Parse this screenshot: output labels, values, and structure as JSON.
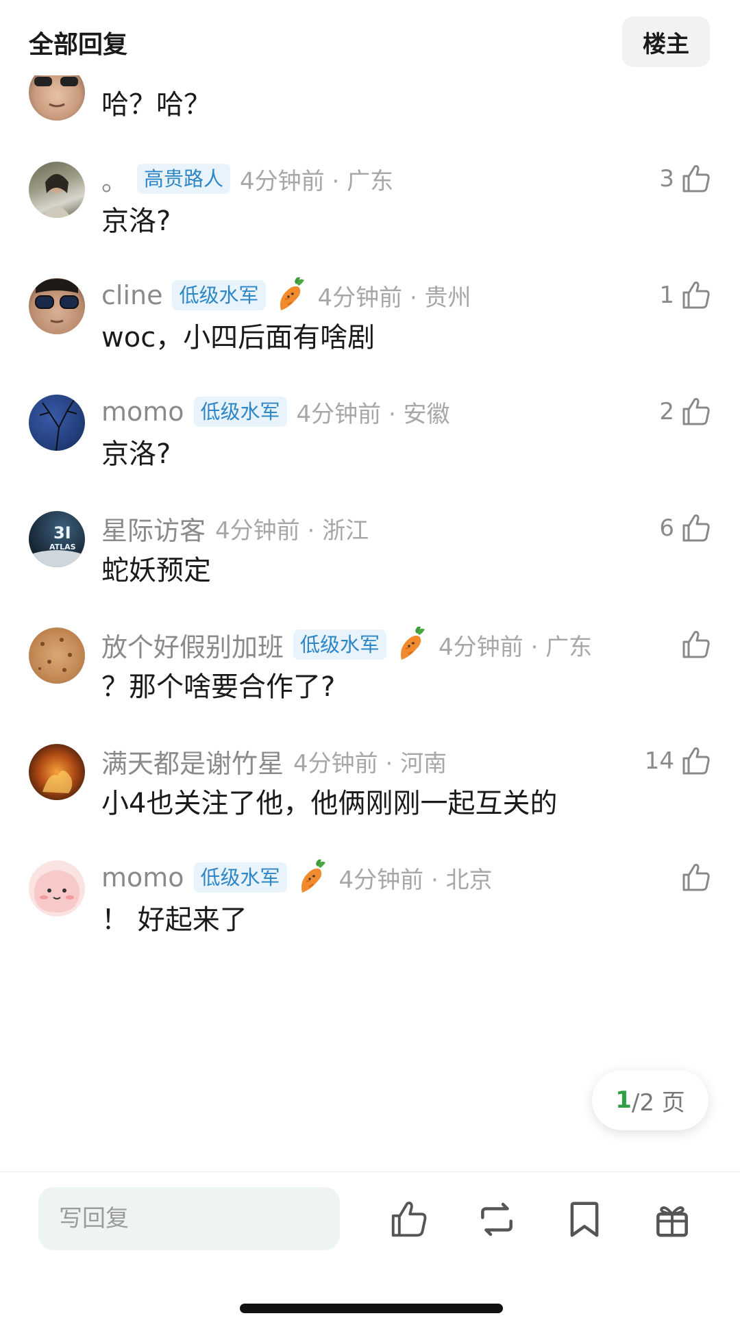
{
  "header": {
    "title": "全部回复",
    "owner_button": "楼主"
  },
  "comments": [
    {
      "user": "",
      "text": "哈？哈？",
      "like_count": ""
    },
    {
      "user": "。",
      "badge": "高贵路人",
      "time": "4分钟前 · 广东",
      "like_count": "3",
      "text": "京洛?"
    },
    {
      "user": "cline",
      "badge": "低级水军",
      "time": "4分钟前 · 贵州",
      "like_count": "1",
      "text": "woc，小四后面有啥剧"
    },
    {
      "user": "momo",
      "badge": "低级水军",
      "time": "4分钟前 · 安徽",
      "like_count": "2",
      "text": "京洛?"
    },
    {
      "user": "星际访客",
      "time": "4分钟前 · 浙江",
      "like_count": "6",
      "text": "蛇妖预定",
      "avatar_text": "3I ATLAS"
    },
    {
      "user": "放个好假别加班",
      "badge": "低级水军",
      "time": "4分钟前 · 广东",
      "like_count": "",
      "text": "？那个啥要合作了?"
    },
    {
      "user": "满天都是谢竹星",
      "time": "4分钟前 · 河南",
      "like_count": "14",
      "text": "小4也关注了他，他俩刚刚一起互关的"
    },
    {
      "user": "momo",
      "badge": "低级水军",
      "time": "4分钟前 · 北京",
      "like_count": "",
      "text": "！ 好起来了"
    }
  ],
  "pager": {
    "current": "1",
    "total_text": "/2 页"
  },
  "bottom_bar": {
    "reply_placeholder": "写回复"
  },
  "icons": [
    "thumb-up-icon",
    "carrot-icon",
    "repost-icon",
    "bookmark-icon",
    "gift-icon"
  ],
  "colors": {
    "badge_bg": "#e8f3fb",
    "badge_text": "#2d86c6",
    "pager_current": "#2ea043"
  }
}
